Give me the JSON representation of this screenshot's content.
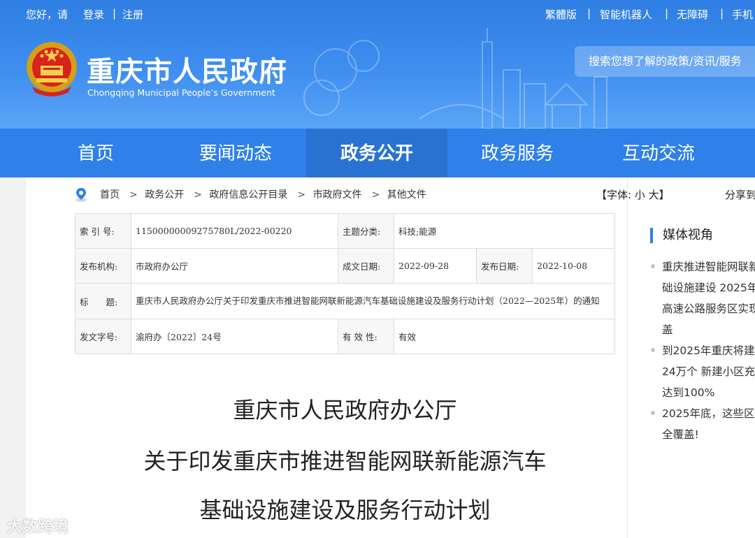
{
  "topbar": {
    "greeting": "您好，请",
    "login": "登录",
    "divider": "|",
    "register": "注册",
    "links": [
      "繁體版",
      "智能机器人",
      "无障碍",
      "手机"
    ]
  },
  "brand": {
    "title": "重庆市人民政府",
    "subtitle": "Chongqing Municipal People’s Government"
  },
  "search": {
    "placeholder": "搜索您想了解的政策/资讯/服务"
  },
  "nav": {
    "items": [
      "首页",
      "要闻动态",
      "政务公开",
      "政务服务",
      "互动交流"
    ],
    "active": "政务公开"
  },
  "breadcrumb": {
    "items": [
      "首页",
      "政务公开",
      "政府信息公开目录",
      "市政府文件",
      "其他文件"
    ],
    "sep": ">"
  },
  "fontsize": {
    "label": "【字体:",
    "small": "小",
    "large": "大】"
  },
  "share": {
    "label": "分享到"
  },
  "info": {
    "index_label": "索 引 号:",
    "index_value": "11500000009275780L/2022-00220",
    "topic_label": "主题分类:",
    "topic_value": "科技;能源",
    "org_label": "发布机构:",
    "org_value": "市政府办公厅",
    "written_label": "成文日期:",
    "written_value": "2022-09-28",
    "publish_label": "发布日期:",
    "publish_value": "2022-10-08",
    "title_label": "标　　题:",
    "title_value": "重庆市人民政府办公厅关于印发重庆市推进智能网联新能源汽车基础设施建设及服务行动计划（2022—2025年）的通知",
    "docno_label": "发文字号:",
    "docno_value": "渝府办〔2022〕24号",
    "valid_label": "有 效 性:",
    "valid_value": "有效"
  },
  "document": {
    "line1": "重庆市人民政府办公厅",
    "line2": "关于印发重庆市推进智能网联新能源汽车",
    "line3": "基础设施建设及服务行动计划"
  },
  "media": {
    "title": "媒体视角",
    "items": [
      {
        "lines": [
          "重庆推进智能网联新",
          "础设施建设 2025年",
          "高速公路服务区实现",
          "盖"
        ]
      },
      {
        "lines": [
          "到2025年重庆将建",
          "24万个 新建小区充",
          "达到100%"
        ]
      },
      {
        "lines": [
          "2025年底，这些区",
          "全覆盖!"
        ]
      }
    ]
  },
  "watermark": "大数跨境",
  "colors": {
    "header": "#2f7ee3",
    "nav": "#2f80e8",
    "nav_active": "#2a72d1",
    "media_accent": "#2f80e8"
  }
}
